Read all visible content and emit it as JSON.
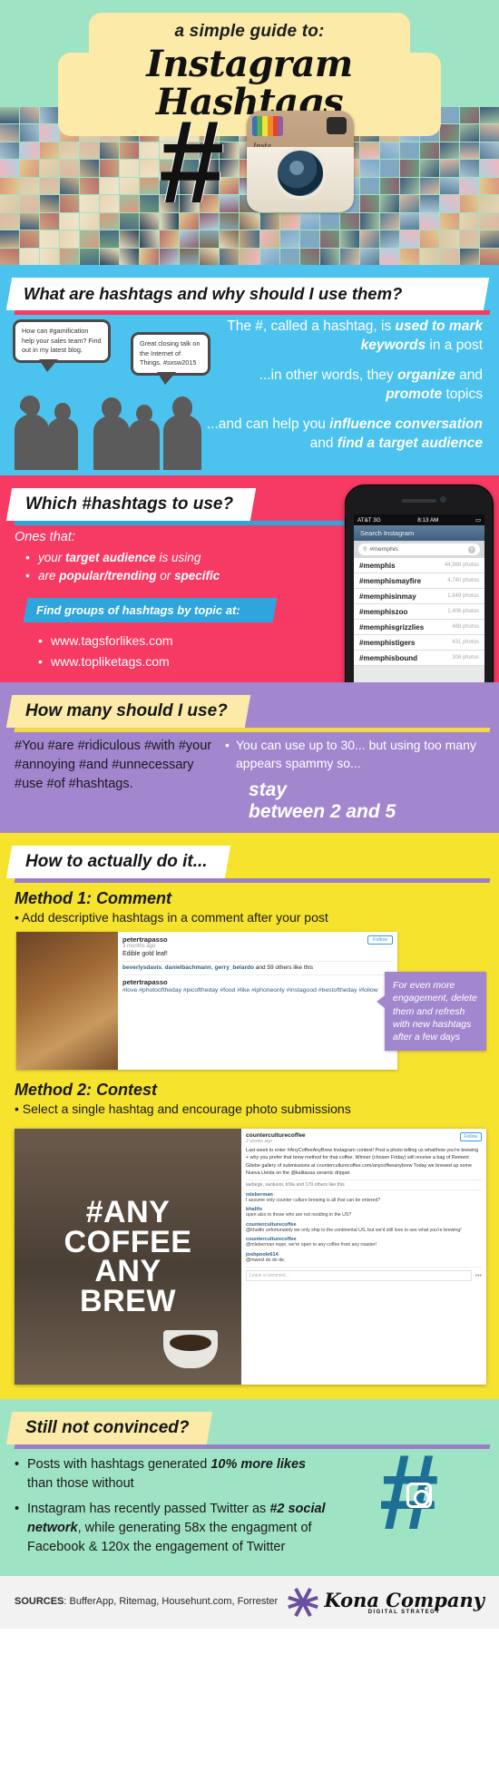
{
  "header": {
    "subtitle": "a simple guide to:",
    "title": "Instagram Hashtags",
    "hash_glyph": "#",
    "camera_label": "Insta"
  },
  "section_what": {
    "heading": "What are hashtags and why should I use them?",
    "bubble_1": "How can #gamification help your sales team? Find out in my latest blog.",
    "bubble_2": "Great closing talk on the Internet of Things. #sxsw2015",
    "para_1_pre": "The #, called a hashtag, is ",
    "para_1_bold": "used to mark keywords",
    "para_1_post": " in a post",
    "para_2_pre": "...in other words, they ",
    "para_2_bold_a": "organize",
    "para_2_mid": " and ",
    "para_2_bold_b": "promote",
    "para_2_post": " topics",
    "para_3_pre": "...and can help you ",
    "para_3_bold_a": "influence conversation",
    "para_3_mid": " and ",
    "para_3_bold_b": "find a target audience"
  },
  "section_which": {
    "heading": "Which #hashtags to use?",
    "lead": "Ones that:",
    "bullets": [
      {
        "pre": "your ",
        "bold": "target audience",
        "post": " is using"
      },
      {
        "pre": "are ",
        "bold": "popular/trending",
        "post": " or ",
        "bold2": "specific"
      }
    ],
    "find_bar": "Find groups of hashtags by topic at:",
    "urls": [
      "www.tagsforlikes.com",
      "www.topliketags.com"
    ],
    "phone": {
      "carrier": "AT&T",
      "network": "3G",
      "time": "8:13 AM",
      "nav_title": "Search Instagram",
      "search_value": "#memphis",
      "search_icon": "search-icon",
      "clear_icon": "clear-icon",
      "results": [
        {
          "tag": "#memphis",
          "count": "44,988 photos"
        },
        {
          "tag": "#memphismayfire",
          "count": "4,740 photos"
        },
        {
          "tag": "#memphisinmay",
          "count": "1,849 photos"
        },
        {
          "tag": "#memphiszoo",
          "count": "1,406 photos"
        },
        {
          "tag": "#memphisgrizzlies",
          "count": "488 photos"
        },
        {
          "tag": "#memphistigers",
          "count": "431 photos"
        },
        {
          "tag": "#memphisbound",
          "count": "308 photos"
        }
      ],
      "tabs": [
        "home-icon",
        "star-icon",
        "camera-icon",
        "comment-icon",
        "profile-icon"
      ]
    }
  },
  "section_howmany": {
    "heading": "How many should I use?",
    "spam_example": "#You #are #ridiculous #with #your #annoying #and #unnecessary #use #of #hashtags.",
    "bullet": "You can use up to 30... but using too many appears spammy so...",
    "big_line_1": "stay",
    "big_line_2": "between 2 and 5"
  },
  "section_howto": {
    "heading": "How to actually do it...",
    "method1_title": "Method 1: Comment",
    "method1_sub": "Add descriptive hashtags in a comment after your post",
    "post": {
      "user": "petertrapasso",
      "time": "3 months ago",
      "caption": "Edible gold leaf!",
      "follow_label": "Follow",
      "likes_a": "beverlysdavis",
      "likes_b": "danielbachmann",
      "likes_c": "gerry_belardo",
      "likes_tail": "and 59 others like this",
      "comment_user": "petertrapasso",
      "comment_tags": "#love #photooftheday #picoftheday #food #like #iphoneonly #instagood #bestoftheday #follow"
    },
    "callout": "For even more engagement, delete them and refresh with new hashtags after a few days",
    "method2_title": "Method 2: Contest",
    "method2_sub": "Select a single hashtag and encourage photo submissions",
    "contest_photo_text": "#ANY COFFEE ANY BREW",
    "contest": {
      "user": "counterculturecoffee",
      "follow_label": "Follow",
      "time": "2 weeks ago",
      "body": "Last week to enter #AnyCoffeeAnyBrew Instagram contest! Post a photo telling us what/how you're brewing + why you prefer that brew method for that coffee. Winner (chosen Friday) will receive a bag of Rement Gitebe gallery of submissions at counterculturecoffee.com/anycoffeeanybrew Today we brewed up some Nueva Lleida on the @kalitausa ceramic dripper.",
      "likes": "iaebege, santuvor, tr0la and 179 others like this",
      "comments": [
        {
          "user": "mleberman",
          "text": "I assume only counter culture brewing is all that can be entered?"
        },
        {
          "user": "khalifo",
          "text": "open also to those who are not residing in the US?"
        },
        {
          "user": "counterculturecoffee",
          "text": "@khalifo unfortunately we only ship to the continental US, but we'd still love to see what you're brewing!"
        },
        {
          "user": "counterculturecoffee",
          "text": "@mleberman nope, we're open to any coffee from any roaster!"
        },
        {
          "user": "joshpoole614",
          "text": "@mwest do do de."
        }
      ],
      "input_placeholder": "Leave a comment..."
    }
  },
  "section_convinced": {
    "heading": "Still not convinced?",
    "bullets": [
      {
        "pre": "Posts with hashtags generated ",
        "bold": "10% more likes",
        "post": " than those without"
      },
      {
        "pre": "Instagram has recently passed Twitter as ",
        "bold": "#2 social network",
        "post": ", while generating 58x the engagment of Facebook & 120x the engagement of Twitter"
      }
    ],
    "hash_glyph": "#"
  },
  "footer": {
    "sources_label": "SOURCES",
    "sources_text": ": BufferApp, Ritemag, Househunt.com, Forrester",
    "brand": "Kona Company",
    "brand_sub": "DIGITAL STRATEGY"
  },
  "colors": {
    "mint": "#9fe3c5",
    "cream": "#fbeaa8",
    "blue": "#4cc3ee",
    "pink": "#f73a63",
    "purple": "#a287cf",
    "yellow": "#f6e32e",
    "teal_hash": "#1e6f96"
  }
}
